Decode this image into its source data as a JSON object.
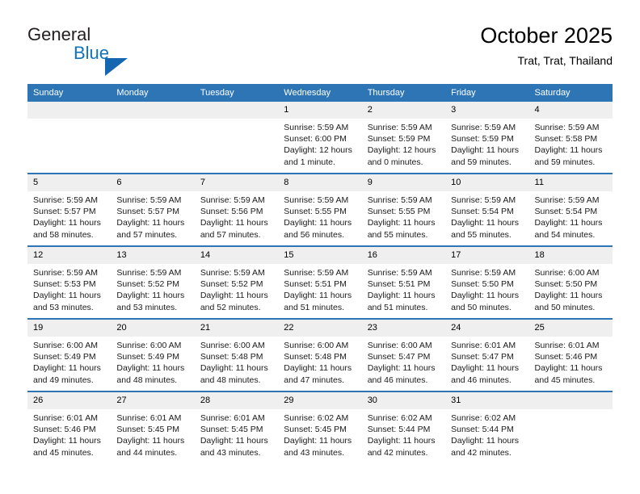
{
  "brand": {
    "name_part1": "General",
    "name_part2": "Blue",
    "triangle_color": "#1566b0",
    "blue_text_color": "#1273bd"
  },
  "header": {
    "title": "October 2025",
    "subtitle": "Trat, Trat, Thailand",
    "accent_color": "#2e75b6",
    "day_band_color": "#efefef"
  },
  "weekdays": [
    "Sunday",
    "Monday",
    "Tuesday",
    "Wednesday",
    "Thursday",
    "Friday",
    "Saturday"
  ],
  "weeks": [
    [
      {
        "day": "",
        "empty": true,
        "sunrise": "",
        "sunset": "",
        "daylight1": "",
        "daylight2": ""
      },
      {
        "day": "",
        "empty": true,
        "sunrise": "",
        "sunset": "",
        "daylight1": "",
        "daylight2": ""
      },
      {
        "day": "",
        "empty": true,
        "sunrise": "",
        "sunset": "",
        "daylight1": "",
        "daylight2": ""
      },
      {
        "day": "1",
        "sunrise": "Sunrise: 5:59 AM",
        "sunset": "Sunset: 6:00 PM",
        "daylight1": "Daylight: 12 hours",
        "daylight2": "and 1 minute."
      },
      {
        "day": "2",
        "sunrise": "Sunrise: 5:59 AM",
        "sunset": "Sunset: 5:59 PM",
        "daylight1": "Daylight: 12 hours",
        "daylight2": "and 0 minutes."
      },
      {
        "day": "3",
        "sunrise": "Sunrise: 5:59 AM",
        "sunset": "Sunset: 5:59 PM",
        "daylight1": "Daylight: 11 hours",
        "daylight2": "and 59 minutes."
      },
      {
        "day": "4",
        "sunrise": "Sunrise: 5:59 AM",
        "sunset": "Sunset: 5:58 PM",
        "daylight1": "Daylight: 11 hours",
        "daylight2": "and 59 minutes."
      }
    ],
    [
      {
        "day": "5",
        "sunrise": "Sunrise: 5:59 AM",
        "sunset": "Sunset: 5:57 PM",
        "daylight1": "Daylight: 11 hours",
        "daylight2": "and 58 minutes."
      },
      {
        "day": "6",
        "sunrise": "Sunrise: 5:59 AM",
        "sunset": "Sunset: 5:57 PM",
        "daylight1": "Daylight: 11 hours",
        "daylight2": "and 57 minutes."
      },
      {
        "day": "7",
        "sunrise": "Sunrise: 5:59 AM",
        "sunset": "Sunset: 5:56 PM",
        "daylight1": "Daylight: 11 hours",
        "daylight2": "and 57 minutes."
      },
      {
        "day": "8",
        "sunrise": "Sunrise: 5:59 AM",
        "sunset": "Sunset: 5:55 PM",
        "daylight1": "Daylight: 11 hours",
        "daylight2": "and 56 minutes."
      },
      {
        "day": "9",
        "sunrise": "Sunrise: 5:59 AM",
        "sunset": "Sunset: 5:55 PM",
        "daylight1": "Daylight: 11 hours",
        "daylight2": "and 55 minutes."
      },
      {
        "day": "10",
        "sunrise": "Sunrise: 5:59 AM",
        "sunset": "Sunset: 5:54 PM",
        "daylight1": "Daylight: 11 hours",
        "daylight2": "and 55 minutes."
      },
      {
        "day": "11",
        "sunrise": "Sunrise: 5:59 AM",
        "sunset": "Sunset: 5:54 PM",
        "daylight1": "Daylight: 11 hours",
        "daylight2": "and 54 minutes."
      }
    ],
    [
      {
        "day": "12",
        "sunrise": "Sunrise: 5:59 AM",
        "sunset": "Sunset: 5:53 PM",
        "daylight1": "Daylight: 11 hours",
        "daylight2": "and 53 minutes."
      },
      {
        "day": "13",
        "sunrise": "Sunrise: 5:59 AM",
        "sunset": "Sunset: 5:52 PM",
        "daylight1": "Daylight: 11 hours",
        "daylight2": "and 53 minutes."
      },
      {
        "day": "14",
        "sunrise": "Sunrise: 5:59 AM",
        "sunset": "Sunset: 5:52 PM",
        "daylight1": "Daylight: 11 hours",
        "daylight2": "and 52 minutes."
      },
      {
        "day": "15",
        "sunrise": "Sunrise: 5:59 AM",
        "sunset": "Sunset: 5:51 PM",
        "daylight1": "Daylight: 11 hours",
        "daylight2": "and 51 minutes."
      },
      {
        "day": "16",
        "sunrise": "Sunrise: 5:59 AM",
        "sunset": "Sunset: 5:51 PM",
        "daylight1": "Daylight: 11 hours",
        "daylight2": "and 51 minutes."
      },
      {
        "day": "17",
        "sunrise": "Sunrise: 5:59 AM",
        "sunset": "Sunset: 5:50 PM",
        "daylight1": "Daylight: 11 hours",
        "daylight2": "and 50 minutes."
      },
      {
        "day": "18",
        "sunrise": "Sunrise: 6:00 AM",
        "sunset": "Sunset: 5:50 PM",
        "daylight1": "Daylight: 11 hours",
        "daylight2": "and 50 minutes."
      }
    ],
    [
      {
        "day": "19",
        "sunrise": "Sunrise: 6:00 AM",
        "sunset": "Sunset: 5:49 PM",
        "daylight1": "Daylight: 11 hours",
        "daylight2": "and 49 minutes."
      },
      {
        "day": "20",
        "sunrise": "Sunrise: 6:00 AM",
        "sunset": "Sunset: 5:49 PM",
        "daylight1": "Daylight: 11 hours",
        "daylight2": "and 48 minutes."
      },
      {
        "day": "21",
        "sunrise": "Sunrise: 6:00 AM",
        "sunset": "Sunset: 5:48 PM",
        "daylight1": "Daylight: 11 hours",
        "daylight2": "and 48 minutes."
      },
      {
        "day": "22",
        "sunrise": "Sunrise: 6:00 AM",
        "sunset": "Sunset: 5:48 PM",
        "daylight1": "Daylight: 11 hours",
        "daylight2": "and 47 minutes."
      },
      {
        "day": "23",
        "sunrise": "Sunrise: 6:00 AM",
        "sunset": "Sunset: 5:47 PM",
        "daylight1": "Daylight: 11 hours",
        "daylight2": "and 46 minutes."
      },
      {
        "day": "24",
        "sunrise": "Sunrise: 6:01 AM",
        "sunset": "Sunset: 5:47 PM",
        "daylight1": "Daylight: 11 hours",
        "daylight2": "and 46 minutes."
      },
      {
        "day": "25",
        "sunrise": "Sunrise: 6:01 AM",
        "sunset": "Sunset: 5:46 PM",
        "daylight1": "Daylight: 11 hours",
        "daylight2": "and 45 minutes."
      }
    ],
    [
      {
        "day": "26",
        "sunrise": "Sunrise: 6:01 AM",
        "sunset": "Sunset: 5:46 PM",
        "daylight1": "Daylight: 11 hours",
        "daylight2": "and 45 minutes."
      },
      {
        "day": "27",
        "sunrise": "Sunrise: 6:01 AM",
        "sunset": "Sunset: 5:45 PM",
        "daylight1": "Daylight: 11 hours",
        "daylight2": "and 44 minutes."
      },
      {
        "day": "28",
        "sunrise": "Sunrise: 6:01 AM",
        "sunset": "Sunset: 5:45 PM",
        "daylight1": "Daylight: 11 hours",
        "daylight2": "and 43 minutes."
      },
      {
        "day": "29",
        "sunrise": "Sunrise: 6:02 AM",
        "sunset": "Sunset: 5:45 PM",
        "daylight1": "Daylight: 11 hours",
        "daylight2": "and 43 minutes."
      },
      {
        "day": "30",
        "sunrise": "Sunrise: 6:02 AM",
        "sunset": "Sunset: 5:44 PM",
        "daylight1": "Daylight: 11 hours",
        "daylight2": "and 42 minutes."
      },
      {
        "day": "31",
        "sunrise": "Sunrise: 6:02 AM",
        "sunset": "Sunset: 5:44 PM",
        "daylight1": "Daylight: 11 hours",
        "daylight2": "and 42 minutes."
      },
      {
        "day": "",
        "empty": true,
        "sunrise": "",
        "sunset": "",
        "daylight1": "",
        "daylight2": ""
      }
    ]
  ]
}
